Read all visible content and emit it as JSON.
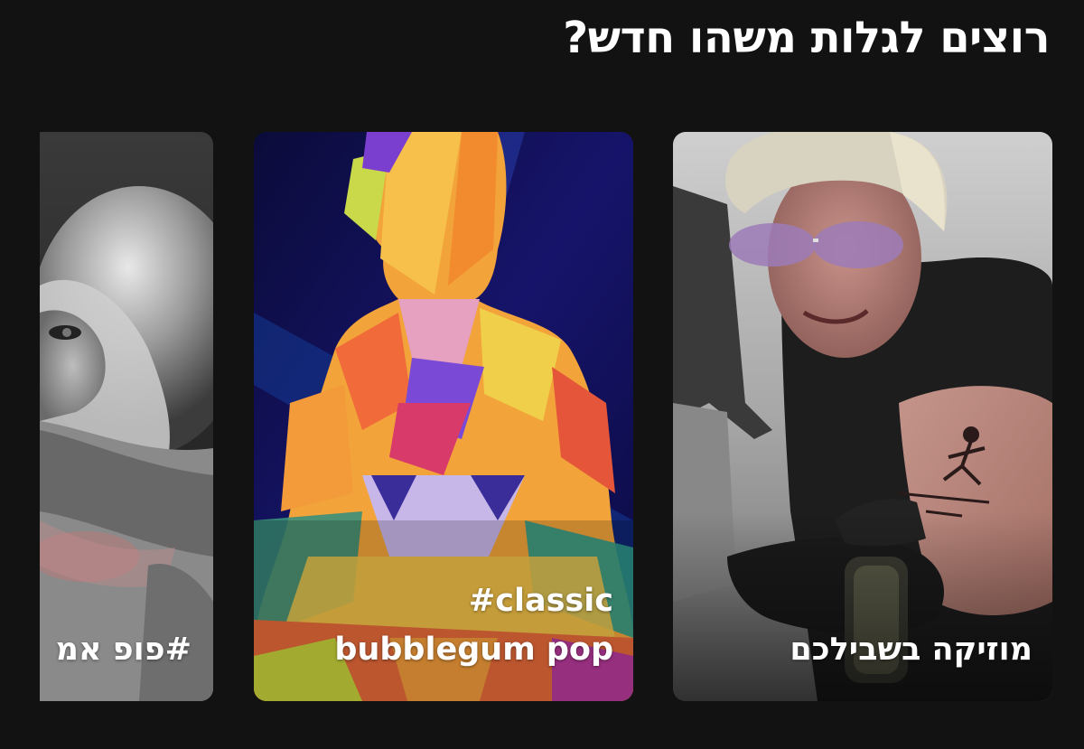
{
  "section": {
    "title": "רוצים לגלות משהו חדש?"
  },
  "cards": [
    {
      "id": "pop",
      "label": "#פופ אמ",
      "image": "bw-portrait-photo"
    },
    {
      "id": "classic",
      "label_line1": "#classic",
      "label_line2": "bubblegum pop",
      "image": "colorful-silhouette-art"
    },
    {
      "id": "for-you",
      "label": "מוזיקה בשבילכם",
      "image": "tattoo-photo"
    }
  ],
  "colors": {
    "background": "#121212",
    "text": "#ffffff"
  }
}
